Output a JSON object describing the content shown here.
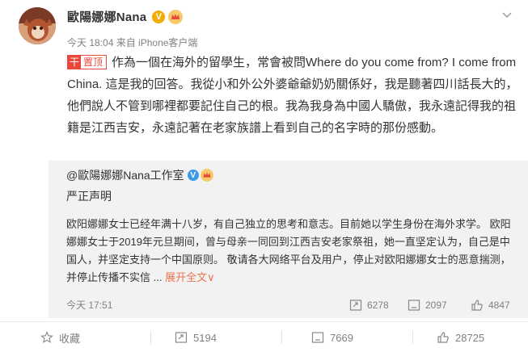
{
  "post": {
    "author": "歐陽娜娜Nana",
    "verified_mark": "V",
    "time": "今天 18:04",
    "source": "来自 iPhone客户端",
    "pin_label": "置顶",
    "pin_mark": "干",
    "text": "作為一個在海外的留學生，常會被問Where do you come from? I come from China. 這是我的回答。我從小和外公外婆爺爺奶奶關係好，我是聽著四川話長大的，他們說人不管到哪裡都要記住自己的根。我為我身為中國人驕傲，我永遠記得我的祖籍是江西吉安，永遠記著在老家族譜上看到自己的名字時的那份感動。"
  },
  "repost": {
    "author": "@歐陽娜娜Nana工作室",
    "verified_mark": "V",
    "title": "严正声明",
    "body": "欧阳娜娜女士已经年满十八岁，有自己独立的思考和意志。目前她以学生身份在海外求学。 欧阳娜娜女士于2019年元旦期间，曾与母亲一同回到江西吉安老家祭祖，她一直坚定认为，自己是中国人，并坚定支持一个中国原则。 敬请各大网络平台及用户，停止对欧阳娜娜女士的恶意揣测，并停止传播不实信 ...",
    "expand": "展开全文",
    "expand_arrow": "∨",
    "time": "今天 17:51",
    "reposts": "6278",
    "comments": "2097",
    "likes": "4847"
  },
  "toolbar": {
    "favorite": "收藏",
    "reposts": "5194",
    "comments": "7669",
    "likes": "28725"
  },
  "colors": {
    "pin_red": "#e8483a",
    "link_orange": "#eb7350",
    "gold_badge": "#f6ab00",
    "blue_badge": "#3d9ae8",
    "repost_bg": "#f2f2f2"
  },
  "icons": [
    "avatar",
    "verified-badge-icon",
    "crown-icon",
    "chevron-down-icon",
    "repost-icon",
    "comment-icon",
    "like-icon",
    "star-icon"
  ]
}
